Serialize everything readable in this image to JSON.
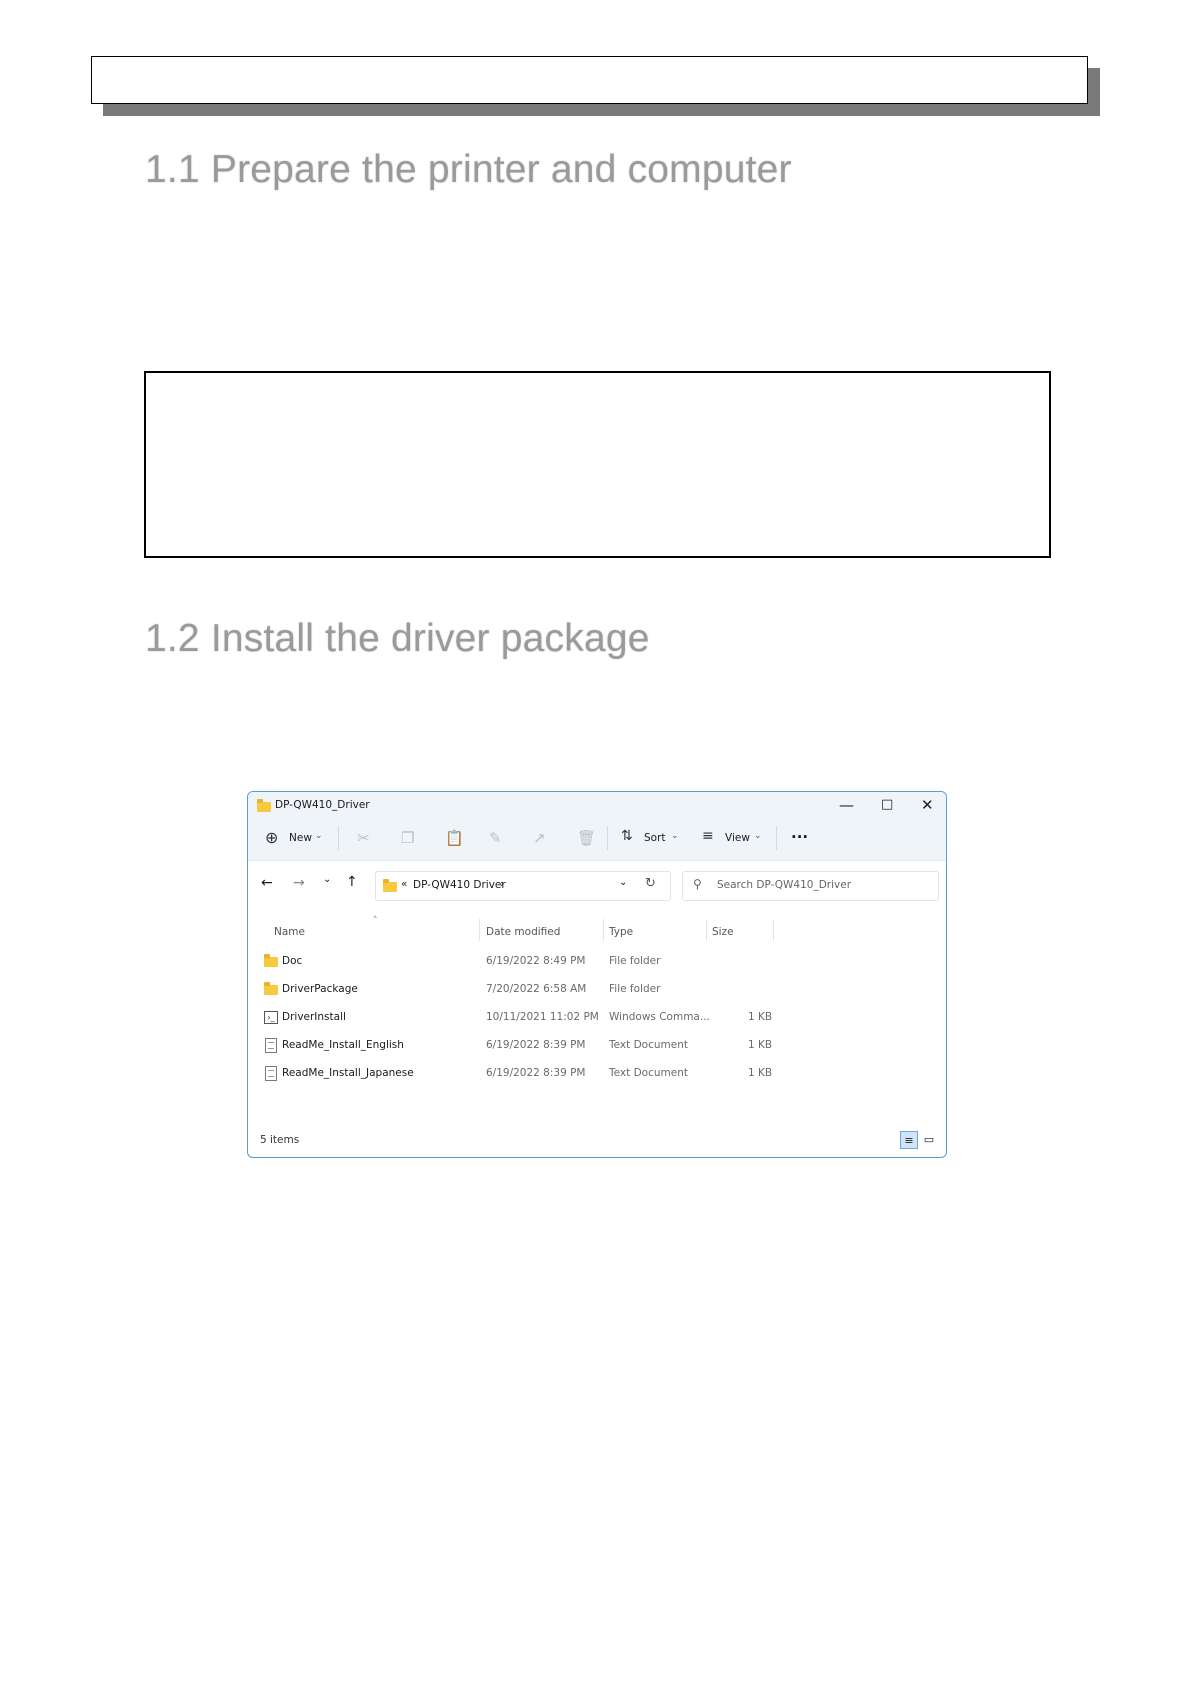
{
  "doc": {
    "heading1": "1.1 Prepare the printer and computer",
    "heading2": "1.2 Install the driver package"
  },
  "explorer": {
    "title": "DP-QW410_Driver",
    "toolbar": {
      "new_label": "New",
      "sort_label": "Sort",
      "view_label": "View",
      "more_label": "···"
    },
    "address": {
      "prefix": "«",
      "path": "DP-QW410 Driver",
      "chevron": "›"
    },
    "search": {
      "placeholder": "Search DP-QW410_Driver"
    },
    "columns": [
      "Name",
      "Date modified",
      "Type",
      "Size"
    ],
    "rows": [
      {
        "name": "Doc",
        "date": "6/19/2022 8:49 PM",
        "type": "File folder",
        "size": "",
        "icon": "folder-icon"
      },
      {
        "name": "DriverPackage",
        "date": "7/20/2022 6:58 AM",
        "type": "File folder",
        "size": "",
        "icon": "folder-icon"
      },
      {
        "name": "DriverInstall",
        "date": "10/11/2021 11:02 PM",
        "type": "Windows Comma...",
        "size": "1 KB",
        "icon": "command-script-icon"
      },
      {
        "name": "ReadMe_Install_English",
        "date": "6/19/2022 8:39 PM",
        "type": "Text Document",
        "size": "1 KB",
        "icon": "text-document-icon"
      },
      {
        "name": "ReadMe_Install_Japanese",
        "date": "6/19/2022 8:39 PM",
        "type": "Text Document",
        "size": "1 KB",
        "icon": "text-document-icon"
      }
    ],
    "status": "5 items"
  }
}
